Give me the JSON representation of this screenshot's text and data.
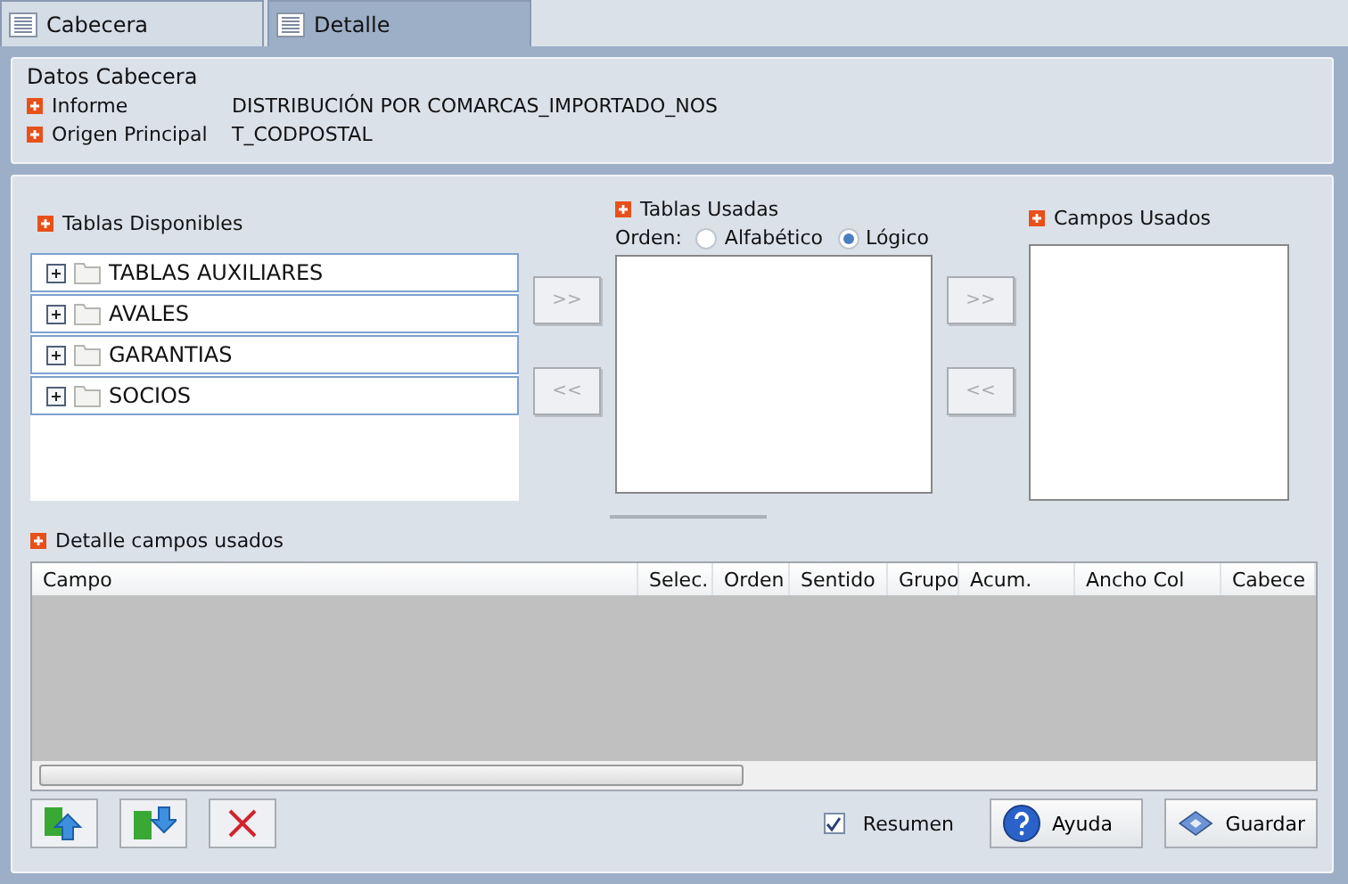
{
  "tabs": [
    {
      "label": "Cabecera",
      "selected": false
    },
    {
      "label": "Detalle",
      "selected": true
    }
  ],
  "header": {
    "title": "Datos Cabecera",
    "fields": [
      {
        "label": "Informe",
        "value": "DISTRIBUCIÓN POR COMARCAS_IMPORTADO_NOS"
      },
      {
        "label": "Origen Principal",
        "value": "T_CODPOSTAL"
      }
    ]
  },
  "available_tables": {
    "title": "Tablas Disponibles",
    "items": [
      {
        "label": "TABLAS AUXILIARES",
        "expanded": false
      },
      {
        "label": "AVALES",
        "expanded": false
      },
      {
        "label": "GARANTIAS",
        "expanded": false
      },
      {
        "label": "SOCIOS",
        "expanded": false
      }
    ]
  },
  "transfer_buttons_1": [
    ">>",
    "<<"
  ],
  "used_tables": {
    "title": "Tablas Usadas",
    "order_label": "Orden:",
    "order_options": [
      {
        "label": "Alfabético",
        "selected": false
      },
      {
        "label": "Lógico",
        "selected": true
      }
    ]
  },
  "transfer_buttons_2": [
    ">>",
    "<<"
  ],
  "used_fields": {
    "title": "Campos Usados"
  },
  "detail": {
    "title": "Detalle campos usados",
    "columns": [
      "Campo",
      "Selec.",
      "Orden",
      "Sentido",
      "Grupo",
      "Acum.",
      "Ancho Col",
      "Cabece"
    ]
  },
  "footer": {
    "summary": {
      "label": "Resumen",
      "checked": true
    },
    "buttons": [
      "Ayuda",
      "Guardar"
    ]
  }
}
